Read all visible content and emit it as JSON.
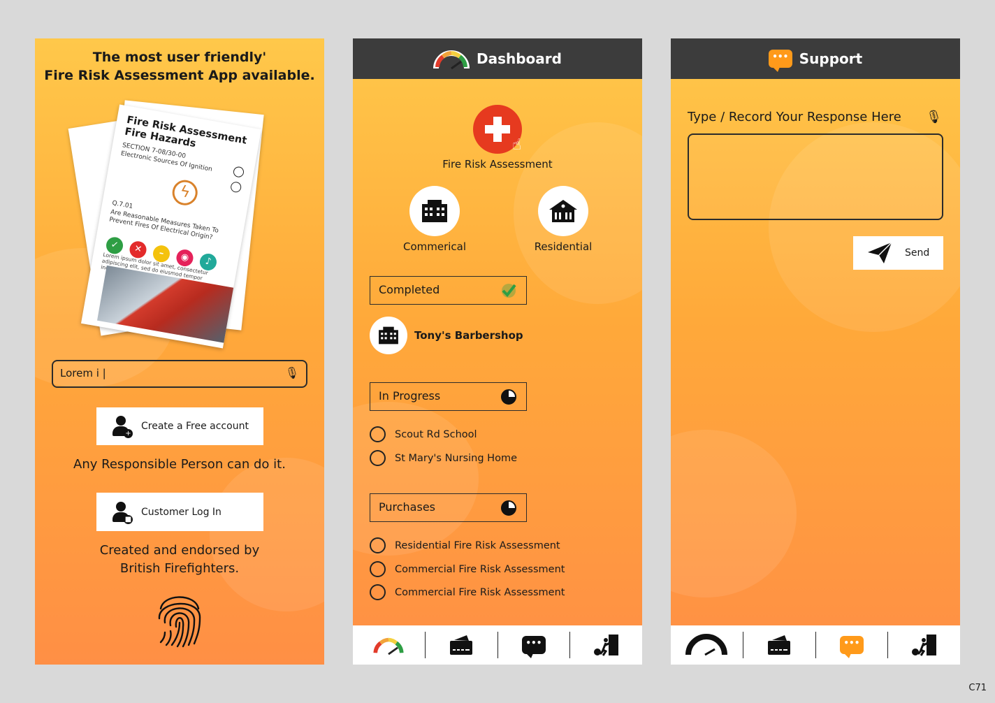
{
  "login_screen": {
    "headline_line1": "The most user friendly'",
    "headline_line2": "Fire Risk Assessment App available.",
    "mock_doc": {
      "title_line1": "Fire Risk Assessment",
      "title_line2": "Fire Hazards",
      "section": "SECTION 7-08/30-00",
      "section_name": "Electronic Sources Of Ignition",
      "question_no": "Q.7.01",
      "question": "Are Reasonable Measures Taken To Prevent Fires Of Electrical Origin?",
      "lorem": "Lorem ipsum dolor sit amet, consectetur adipiscing elit, sed do eiusmod tempor incididunt ut labore et dolore magna"
    },
    "search_value": "Lorem i |",
    "create_account_label": "Create a Free account",
    "responsible_text": "Any Responsible Person can do it.",
    "login_label": "Customer Log In",
    "endorsed_line1": "Created and endorsed by",
    "endorsed_line2": "British Firefighters."
  },
  "dashboard": {
    "title": "Dashboard",
    "fra_label": "Fire Risk Assessment",
    "commercial_label": "Commerical",
    "residential_label": "Residential",
    "completed_label": "Completed",
    "completed_items": [
      "Tony's Barbershop"
    ],
    "in_progress_label": "In Progress",
    "in_progress_items": [
      "Scout Rd School",
      "St Mary's Nursing Home"
    ],
    "purchases_label": "Purchases",
    "purchase_items": [
      "Residential Fire Risk Assessment",
      "Commercial Fire Risk Assessment",
      "Commercial Fire Risk Assessment"
    ]
  },
  "support": {
    "title": "Support",
    "prompt": "Type / Record Your Response Here",
    "send_label": "Send"
  },
  "footer_code": "C71",
  "colors": {
    "accent": "#ff9a1a",
    "header": "#3c3c3c",
    "fra_red": "#e63a1f"
  }
}
